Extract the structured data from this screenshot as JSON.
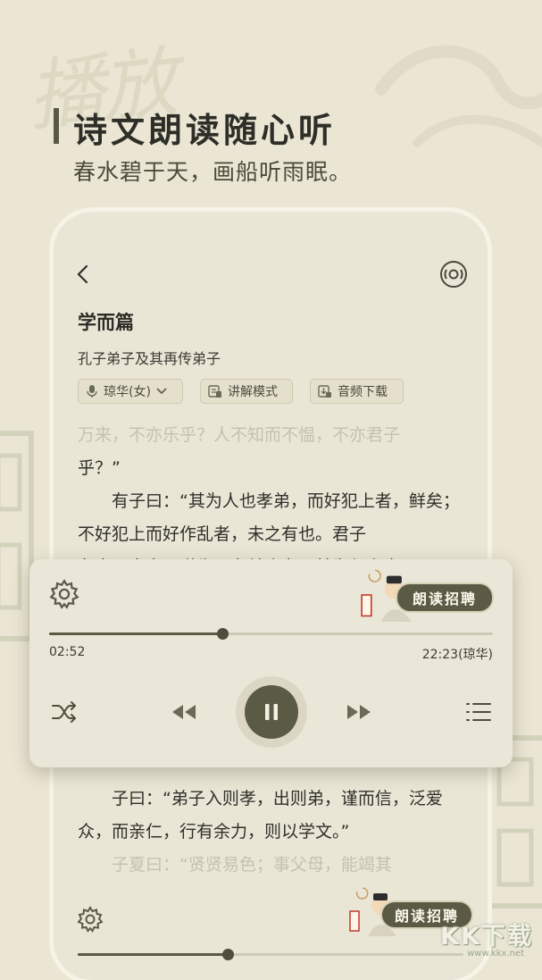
{
  "hero": {
    "title": "诗文朗读随心听",
    "subtitle": "春水碧于天，画船听雨眠。"
  },
  "calligraphy_text": "播放",
  "chapter": {
    "title": "学而篇",
    "author": "孔子弟子及其再传弟子"
  },
  "chips": {
    "voice": "琼华(女)",
    "explain": "讲解模式",
    "download": "音频下载"
  },
  "article": {
    "line_faded": "万来，不亦乐乎？人不知而不愠，不亦君子",
    "line_end": "乎？”",
    "para2": "有子曰：“其为人也孝弟，而好犯上者，鲜矣；不好犯上而好作乱者，未之有也。君子",
    "para3_clipped": "务本，本立而道生。孝弟也者，其为仁之本",
    "para4": "子曰：“弟子入则孝，出则弟，谨而信，泛爱众，而亲仁，行有余力，则以学文。”",
    "para5": "子夏曰：“贤贤易色；事父母，能竭其"
  },
  "player": {
    "recruit_label": "朗读招聘",
    "current_time": "02:52",
    "total_time": "22:23(琼华)",
    "progress": 0.39
  },
  "bottom_player": {
    "recruit_label": "朗读招聘",
    "progress": 0.39
  },
  "watermark": {
    "text": "KK下载",
    "url": "www.kkx.net"
  },
  "colors": {
    "background": "#ebe6d4",
    "accent": "#5b5a45",
    "card": "#eae6d6"
  }
}
